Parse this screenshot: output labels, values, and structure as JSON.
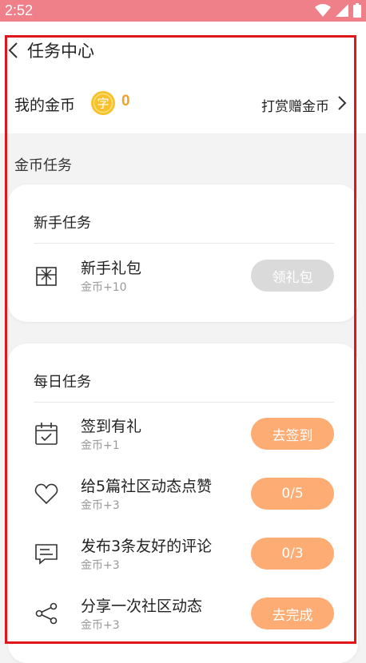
{
  "status_bar": {
    "time": "2:52"
  },
  "header": {
    "title": "任务中心"
  },
  "coins": {
    "label": "我的金币",
    "coin_icon_glyph": "字",
    "value": "0",
    "reward_link": "打赏赠金币"
  },
  "section_title": "金币任务",
  "newbie": {
    "title": "新手任务",
    "tasks": [
      {
        "icon": "gift-icon",
        "name": "新手礼包",
        "reward": "金币+10",
        "button": "领礼包",
        "button_state": "disabled"
      }
    ]
  },
  "daily": {
    "title": "每日任务",
    "tasks": [
      {
        "icon": "calendar-check-icon",
        "name": "签到有礼",
        "reward": "金币+1",
        "button": "去签到"
      },
      {
        "icon": "heart-icon",
        "name": "给5篇社区动态点赞",
        "reward": "金币+3",
        "button": "0/5"
      },
      {
        "icon": "comment-icon",
        "name": "发布3条友好的评论",
        "reward": "金币+3",
        "button": "0/3"
      },
      {
        "icon": "share-icon",
        "name": "分享一次社区动态",
        "reward": "金币+3",
        "button": "去完成"
      }
    ]
  },
  "colors": {
    "status_bar": "#ef7f89",
    "accent_orange": "#fdac73",
    "coin_value": "#f2a229",
    "disabled_button": "#dadada",
    "annotation_frame": "#e0161d"
  }
}
